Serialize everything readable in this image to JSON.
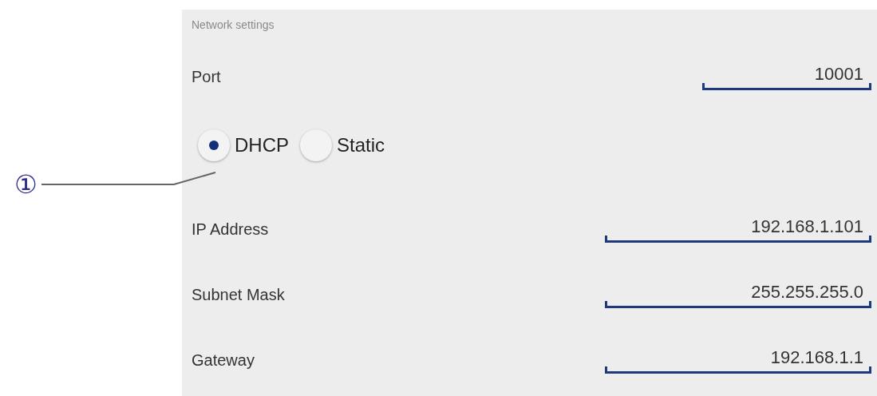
{
  "annotation": {
    "marker": "①"
  },
  "panel": {
    "title": "Network settings"
  },
  "port": {
    "label": "Port",
    "value": "10001"
  },
  "mode": [
    {
      "label": "DHCP",
      "selected": true
    },
    {
      "label": "Static",
      "selected": false
    }
  ],
  "fields": [
    {
      "label": "IP Address",
      "value": "192.168.1.101"
    },
    {
      "label": "Subnet Mask",
      "value": "255.255.255.0"
    },
    {
      "label": "Gateway",
      "value": "192.168.1.1"
    }
  ]
}
